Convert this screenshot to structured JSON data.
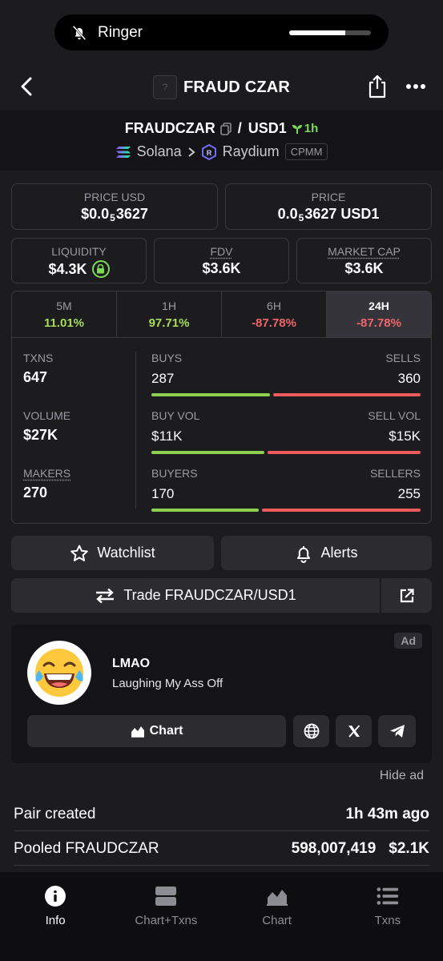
{
  "status": {
    "ringer_label": "Ringer",
    "ringer_volume_fraction": 0.69
  },
  "header": {
    "title": "FRAUD CZAR",
    "token_placeholder": "?"
  },
  "pair": {
    "base": "FRAUDCZAR",
    "quote": "USD1",
    "age": "1h",
    "chain": "Solana",
    "dex": "Raydium",
    "pool_type": "CPMM"
  },
  "price_usd": {
    "label": "PRICE USD",
    "prefix": "$0.0",
    "zeros": "5",
    "digits": "3627"
  },
  "price_native": {
    "label": "PRICE",
    "prefix": "0.0",
    "zeros": "5",
    "digits": "3627 USD1"
  },
  "liquidity": {
    "label": "LIQUIDITY",
    "value": "$4.3K"
  },
  "fdv": {
    "label": "FDV",
    "value": "$3.6K"
  },
  "market_cap": {
    "label": "MARKET CAP",
    "value": "$3.6K"
  },
  "timeframes": [
    {
      "label": "5M",
      "change": "11.01%"
    },
    {
      "label": "1H",
      "change": "97.71%"
    },
    {
      "label": "6H",
      "change": "-87.78%"
    },
    {
      "label": "24H",
      "change": "-87.78%"
    }
  ],
  "stats": {
    "txns_label": "TXNS",
    "txns_value": "647",
    "volume_label": "VOLUME",
    "volume_value": "$27K",
    "makers_label": "MAKERS",
    "makers_value": "270",
    "buys_label": "BUYS",
    "buys_value": "287",
    "sells_label": "SELLS",
    "sells_value": "360",
    "buys_fraction": 0.44,
    "buyvol_label": "BUY VOL",
    "buyvol_value": "$11K",
    "sellvol_label": "SELL VOL",
    "sellvol_value": "$15K",
    "buyvol_fraction": 0.42,
    "buyers_label": "BUYERS",
    "buyers_value": "170",
    "sellers_label": "SELLERS",
    "sellers_value": "255",
    "buyers_fraction": 0.4
  },
  "actions": {
    "watchlist": "Watchlist",
    "alerts": "Alerts",
    "trade": "Trade FRAUDCZAR/USD1"
  },
  "ad": {
    "tag": "Ad",
    "title": "LMAO",
    "subtitle": "Laughing My Ass Off",
    "chart_button": "Chart",
    "hide": "Hide ad"
  },
  "info": [
    {
      "label": "Pair created",
      "value": "1h 43m ago",
      "value2": ""
    },
    {
      "label": "Pooled FRAUDCZAR",
      "value": "598,007,419",
      "value2": "$2.1K"
    }
  ],
  "nav": [
    {
      "label": "Info"
    },
    {
      "label": "Chart+Txns"
    },
    {
      "label": "Chart"
    },
    {
      "label": "Txns"
    }
  ],
  "colors": {
    "positive": "#a8dc5a",
    "negative": "#f0656a",
    "accent_green": "#7ed957"
  }
}
